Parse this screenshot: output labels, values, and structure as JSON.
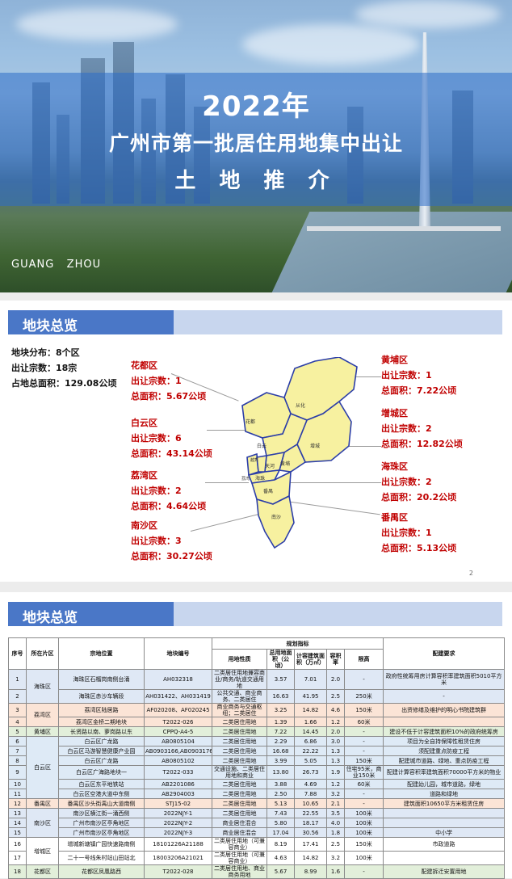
{
  "cover": {
    "year": "2022年",
    "title": "广州市第一批居住用地集中出让",
    "subtitle": "土 地 推 介",
    "watermark": "GUANG   ZHOU"
  },
  "overview": {
    "header": "地块总览",
    "summary": [
      "地块分布：8个区",
      "出让宗数：18宗",
      "占地总面积：129.08公顷"
    ],
    "districts_left": [
      {
        "name": "花都区",
        "count": "出让宗数：1",
        "area": "总面积：5.67公顷"
      },
      {
        "name": "白云区",
        "count": "出让宗数：6",
        "area": "总面积：43.14公顷"
      },
      {
        "name": "荔湾区",
        "count": "出让宗数：2",
        "area": "总面积：4.64公顷"
      },
      {
        "name": "南沙区",
        "count": "出让宗数：3",
        "area": "总面积：30.27公顷"
      }
    ],
    "districts_right": [
      {
        "name": "黄埔区",
        "count": "出让宗数：1",
        "area": "总面积：7.22公顷"
      },
      {
        "name": "增城区",
        "count": "出让宗数：2",
        "area": "总面积：12.82公顷"
      },
      {
        "name": "海珠区",
        "count": "出让宗数：2",
        "area": "总面积：20.2公顷"
      },
      {
        "name": "番禺区",
        "count": "出让宗数：1",
        "area": "总面积：5.13公顷"
      }
    ],
    "map_labels": [
      "从化",
      "花都",
      "白云",
      "增城",
      "黄埔",
      "天河",
      "荔湾",
      "越秀",
      "海珠",
      "番禺",
      "南沙"
    ],
    "page_number": "2"
  },
  "table_section": {
    "header": "地块总览",
    "headers": {
      "seq": "序号",
      "district": "所在片区",
      "location": "宗地位置",
      "code": "地块编号",
      "indicators": "规划指标",
      "use": "用地性质",
      "area": "总用地面积（公顷）",
      "gfa": "计容建筑面积（万㎡）",
      "far": "容积率",
      "height": "限高",
      "requirement": "配建要求"
    },
    "rows": [
      {
        "seq": "1",
        "district": "海珠区",
        "location": "海珠区石榴岗南侧台涌",
        "code": "AH032318",
        "use": "二类居住用地兼容商业/商务/轨道交通用地",
        "area": "3.57",
        "gfa": "7.01",
        "far": "2.0",
        "height": "-",
        "req": "政府性统筹用房计算容积率建筑面积5010平方米",
        "cls": "r-blue"
      },
      {
        "seq": "2",
        "district": "",
        "location": "海珠区赤沙车辆段",
        "code": "AH031422、AH031419",
        "use": "公共交通、商业商务、二类居住",
        "area": "16.63",
        "gfa": "41.95",
        "far": "2.5",
        "height": "250米",
        "req": "-",
        "cls": "r-blue"
      },
      {
        "seq": "3",
        "district": "荔湾区",
        "location": "荔湾区陆居路",
        "code": "AF020208、AF020245",
        "use": "商业商务与交通枢纽；二类居住",
        "area": "3.25",
        "gfa": "14.82",
        "far": "4.6",
        "height": "150米",
        "req": "出资修缮及维护的明心书院建筑群",
        "cls": "r-pink"
      },
      {
        "seq": "4",
        "district": "",
        "location": "荔湾区金桥二期地块",
        "code": "T2022-026",
        "use": "二类居住用地",
        "area": "1.39",
        "gfa": "1.66",
        "far": "1.2",
        "height": "60米",
        "req": "",
        "cls": "r-pink"
      },
      {
        "seq": "5",
        "district": "黄埔区",
        "location": "长贤路以南、萝岗路以东",
        "code": "CPPQ-A4-5",
        "use": "二类居住用地",
        "area": "7.22",
        "gfa": "14.45",
        "far": "2.0",
        "height": "-",
        "req": "建设不低于计容建筑面积10%的政府统筹房",
        "cls": "r-green"
      },
      {
        "seq": "6",
        "district": "白云区",
        "location": "白云区广龙路",
        "code": "AB0805104",
        "use": "二类居住用地",
        "area": "2.29",
        "gfa": "6.86",
        "far": "3.0",
        "height": "-",
        "req": "项目为全自持保障性租赁住房",
        "cls": "r-blue2"
      },
      {
        "seq": "7",
        "district": "",
        "location": "白云区马游智慧健康产业园",
        "code": "AB0903166,AB0903176",
        "use": "二类居住用地",
        "area": "16.68",
        "gfa": "22.22",
        "far": "1.3",
        "height": "-",
        "req": "须配建重点防疫工程",
        "cls": "r-blue2"
      },
      {
        "seq": "8",
        "district": "",
        "location": "白云区广龙路",
        "code": "AB0805102",
        "use": "二类居住用地",
        "area": "3.99",
        "gfa": "5.05",
        "far": "1.3",
        "height": "150米",
        "req": "配建城市道路、绿地、重点防疫工程",
        "cls": "r-blue2"
      },
      {
        "seq": "9",
        "district": "",
        "location": "白云区广海路地块一",
        "code": "T2022-033",
        "use": "交通设施、二类居住用地和商业",
        "area": "13.80",
        "gfa": "26.73",
        "far": "1.9",
        "height": "住宅95米，商业150米",
        "req": "配建计算容积率建筑面积70000平方米的物业",
        "cls": "r-blue2"
      },
      {
        "seq": "10",
        "district": "",
        "location": "白云区东平地铁站",
        "code": "AB2201086",
        "use": "二类居住用地",
        "area": "3.88",
        "gfa": "4.69",
        "far": "1.2",
        "height": "60米",
        "req": "配建幼儿园，城市道路，绿地",
        "cls": "r-blue2"
      },
      {
        "seq": "11",
        "district": "",
        "location": "白云区空港大道中东侧",
        "code": "AB2904003",
        "use": "二类居住用地",
        "area": "2.50",
        "gfa": "7.88",
        "far": "3.2",
        "height": "-",
        "req": "道路和绿地",
        "cls": "r-blue2"
      },
      {
        "seq": "12",
        "district": "番禺区",
        "location": "番禺区沙头街禹山大道南侧",
        "code": "STJ15-02",
        "use": "二类居住用地",
        "area": "5.13",
        "gfa": "10.65",
        "far": "2.1",
        "height": "-",
        "req": "建筑面积10650平方米租赁住房",
        "cls": "r-pink"
      },
      {
        "seq": "13",
        "district": "南沙区",
        "location": "南沙区横江街一涌西侧",
        "code": "2022NJY-1",
        "use": "二类居住用地",
        "area": "7.43",
        "gfa": "22.55",
        "far": "3.5",
        "height": "100米",
        "req": "",
        "cls": "r-blue"
      },
      {
        "seq": "14",
        "district": "",
        "location": "广州市南沙区亭角地区",
        "code": "2022NJY-2",
        "use": "商业居住混合",
        "area": "5.80",
        "gfa": "18.17",
        "far": "4.0",
        "height": "100米",
        "req": "",
        "cls": "r-blue"
      },
      {
        "seq": "15",
        "district": "",
        "location": "广州市南沙区亭角地区",
        "code": "2022NJY-3",
        "use": "商业居住混合",
        "area": "17.04",
        "gfa": "30.56",
        "far": "1.8",
        "height": "100米",
        "req": "中小学",
        "cls": "r-blue"
      },
      {
        "seq": "16",
        "district": "增城区",
        "location": "增城新塘镇广园快速路南侧",
        "code": "18101226A21188",
        "use": "二类居住用地（可兼容商业）",
        "area": "8.19",
        "gfa": "17.41",
        "far": "2.5",
        "height": "150米",
        "req": "市政道路",
        "cls": "r-white"
      },
      {
        "seq": "17",
        "district": "",
        "location": "二十一号线朱村站山田站北",
        "code": "18003206A21021",
        "use": "二类居住用地（可兼容商业）",
        "area": "4.63",
        "gfa": "14.82",
        "far": "3.2",
        "height": "100米",
        "req": "",
        "cls": "r-white"
      },
      {
        "seq": "18",
        "district": "花都区",
        "location": "花都区凤凰路西",
        "code": "T2022-028",
        "use": "二类居住用地、商业商务用地",
        "area": "5.67",
        "gfa": "8.99",
        "far": "1.6",
        "height": "-",
        "req": "配建拆迁安置用地",
        "cls": "r-green"
      }
    ]
  }
}
